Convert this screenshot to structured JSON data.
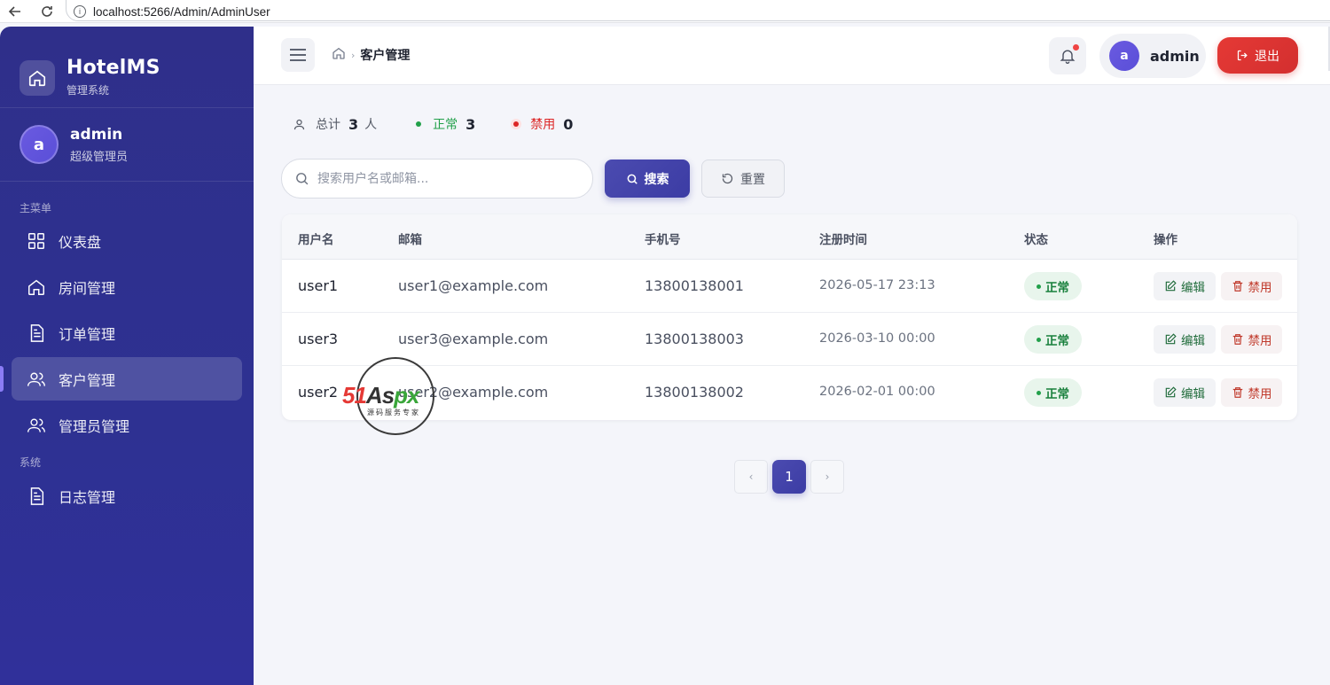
{
  "browser": {
    "url": "localhost:5266/Admin/AdminUser"
  },
  "brand": {
    "title": "HotelMS",
    "subtitle": "管理系统"
  },
  "profile": {
    "avatar_letter": "a",
    "name": "admin",
    "role": "超级管理员"
  },
  "menu": {
    "section_main": "主菜单",
    "section_system": "系统",
    "items": [
      {
        "label": "仪表盘",
        "icon": "dashboard-icon"
      },
      {
        "label": "房间管理",
        "icon": "home-icon"
      },
      {
        "label": "订单管理",
        "icon": "document-icon"
      },
      {
        "label": "客户管理",
        "icon": "users-icon",
        "active": true
      },
      {
        "label": "管理员管理",
        "icon": "users-icon"
      },
      {
        "label": "日志管理",
        "icon": "document-icon"
      }
    ]
  },
  "topbar": {
    "breadcrumb_current": "客户管理",
    "user_letter": "a",
    "user_name": "admin",
    "logout_label": "退出"
  },
  "stats": {
    "total_label": "总计",
    "total_value": "3",
    "total_unit": "人",
    "normal_label": "正常",
    "normal_value": "3",
    "banned_label": "禁用",
    "banned_value": "0"
  },
  "search": {
    "placeholder": "搜索用户名或邮箱...",
    "search_label": "搜索",
    "reset_label": "重置"
  },
  "table": {
    "headers": [
      "用户名",
      "邮箱",
      "手机号",
      "注册时间",
      "状态",
      "操作"
    ],
    "rows": [
      {
        "username": "user1",
        "email": "user1@example.com",
        "phone": "13800138001",
        "registered": "2026-05-17 23:13",
        "status": "正常"
      },
      {
        "username": "user3",
        "email": "user3@example.com",
        "phone": "13800138003",
        "registered": "2026-03-10 00:00",
        "status": "正常"
      },
      {
        "username": "user2",
        "email": "user2@example.com",
        "phone": "13800138002",
        "registered": "2026-02-01 00:00",
        "status": "正常"
      }
    ],
    "edit_label": "编辑",
    "ban_label": "禁用"
  },
  "pagination": {
    "prev": "‹",
    "current": "1",
    "next": "›"
  },
  "watermark": {
    "brand": "51Aspx",
    "tagline": "源码服务专家"
  },
  "colors": {
    "sidebar": "#2e3192",
    "primary": "#3c3ca4",
    "danger": "#e53935",
    "success": "#22a04a"
  }
}
